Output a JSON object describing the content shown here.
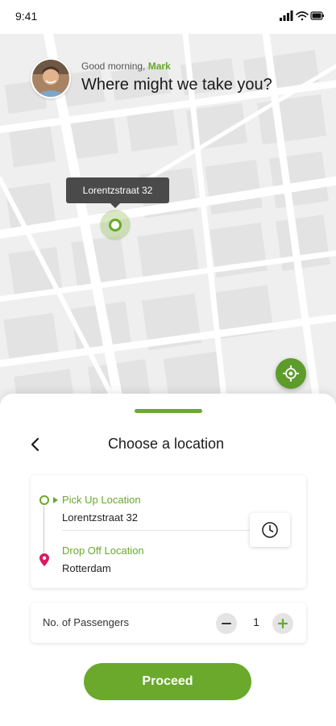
{
  "status_bar": {
    "time": "9:41",
    "icons": [
      "signal-icon",
      "wifi-icon",
      "battery-icon"
    ]
  },
  "greeting": {
    "salutation": "Good morning,",
    "name": "Mark",
    "headline": "Where might we take you?"
  },
  "map": {
    "pin_tooltip": "Lorentzstraat 32",
    "locate_icon": "locate-icon"
  },
  "sheet": {
    "title": "Choose a location",
    "back_icon": "chevron-left-icon"
  },
  "locations": {
    "pickup_label": "Pick Up Location",
    "pickup_value": "Lorentzstraat 32",
    "dropoff_label": "Drop Off Location",
    "dropoff_value": "Rotterdam",
    "schedule_icon": "clock-icon"
  },
  "passengers": {
    "label": "No. of Passengers",
    "count": "1"
  },
  "actions": {
    "proceed_label": "Proceed"
  },
  "colors": {
    "accent": "#6aa92c",
    "accent_dark": "#5d9c2b",
    "dropoff_pin": "#d81b60",
    "map_background": "#f0f0f0"
  }
}
